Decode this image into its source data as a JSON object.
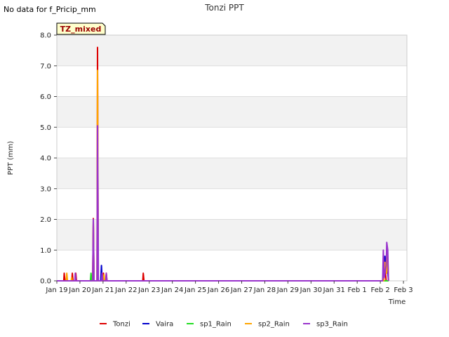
{
  "notice": "No data for f_Pricip_mm",
  "site_badge": "TZ_mixed",
  "chart_data": {
    "type": "line",
    "title": "Tonzi PPT",
    "xlabel": "Time",
    "ylabel": "PPT (mm)",
    "xlim": [
      19.0,
      34.15
    ],
    "ylim": [
      0,
      8
    ],
    "x_ticks": [
      {
        "x": 19,
        "label": "Jan 19"
      },
      {
        "x": 20,
        "label": "Jan 20"
      },
      {
        "x": 21,
        "label": "Jan 21"
      },
      {
        "x": 22,
        "label": "Jan 22"
      },
      {
        "x": 23,
        "label": "Jan 23"
      },
      {
        "x": 24,
        "label": "Jan 24"
      },
      {
        "x": 25,
        "label": "Jan 25"
      },
      {
        "x": 26,
        "label": "Jan 26"
      },
      {
        "x": 27,
        "label": "Jan 27"
      },
      {
        "x": 28,
        "label": "Jan 28"
      },
      {
        "x": 29,
        "label": "Jan 29"
      },
      {
        "x": 30,
        "label": "Jan 30"
      },
      {
        "x": 31,
        "label": "Jan 31"
      },
      {
        "x": 32,
        "label": "Feb 1"
      },
      {
        "x": 33,
        "label": "Feb 2"
      },
      {
        "x": 34,
        "label": "Feb 3"
      }
    ],
    "y_ticks": [
      {
        "y": 0,
        "label": "0.0"
      },
      {
        "y": 1,
        "label": "1.0"
      },
      {
        "y": 2,
        "label": "2.0"
      },
      {
        "y": 3,
        "label": "3.0"
      },
      {
        "y": 4,
        "label": "4.0"
      },
      {
        "y": 5,
        "label": "5.0"
      },
      {
        "y": 6,
        "label": "6.0"
      },
      {
        "y": 7,
        "label": "7.0"
      },
      {
        "y": 8,
        "label": "8.0"
      }
    ],
    "legend_position": "bottom",
    "grid": true,
    "series": [
      {
        "name": "Tonzi",
        "color": "#dd0000",
        "points": [
          [
            19.0,
            0
          ],
          [
            19.3,
            0
          ],
          [
            19.32,
            0.25
          ],
          [
            19.35,
            0
          ],
          [
            19.65,
            0
          ],
          [
            19.67,
            0.25
          ],
          [
            19.7,
            0
          ],
          [
            19.8,
            0
          ],
          [
            19.82,
            0.25
          ],
          [
            19.85,
            0
          ],
          [
            20.55,
            0
          ],
          [
            20.58,
            2.03
          ],
          [
            20.61,
            0
          ],
          [
            20.74,
            0
          ],
          [
            20.76,
            7.6
          ],
          [
            20.79,
            0
          ],
          [
            21.0,
            0
          ],
          [
            21.02,
            0.25
          ],
          [
            21.05,
            0
          ],
          [
            21.12,
            0
          ],
          [
            21.14,
            0.25
          ],
          [
            21.17,
            0
          ],
          [
            22.72,
            0
          ],
          [
            22.74,
            0.25
          ],
          [
            22.77,
            0
          ],
          [
            33.15,
            0
          ],
          [
            33.2,
            0.5
          ],
          [
            33.25,
            0
          ],
          [
            33.35,
            0
          ]
        ]
      },
      {
        "name": "Vaira",
        "color": "#0000cc",
        "points": [
          [
            19.0,
            0
          ],
          [
            20.9,
            0
          ],
          [
            20.93,
            0.5
          ],
          [
            20.96,
            0
          ],
          [
            33.12,
            0
          ],
          [
            33.2,
            0.8
          ],
          [
            33.26,
            0.3
          ],
          [
            33.3,
            0.5
          ],
          [
            33.35,
            0
          ]
        ]
      },
      {
        "name": "sp1_Rain",
        "color": "#22dd22",
        "points": [
          [
            19.0,
            0
          ],
          [
            20.45,
            0
          ],
          [
            20.48,
            0.25
          ],
          [
            20.51,
            0
          ],
          [
            33.35,
            0
          ]
        ]
      },
      {
        "name": "sp2_Rain",
        "color": "#ffa500",
        "points": [
          [
            19.0,
            0
          ],
          [
            19.4,
            0
          ],
          [
            19.43,
            0.25
          ],
          [
            19.46,
            0
          ],
          [
            19.62,
            0
          ],
          [
            19.64,
            0.1
          ],
          [
            19.67,
            0
          ],
          [
            20.55,
            0
          ],
          [
            20.58,
            1.9
          ],
          [
            20.61,
            0
          ],
          [
            20.74,
            0
          ],
          [
            20.76,
            6.85
          ],
          [
            20.79,
            0
          ],
          [
            21.02,
            0
          ],
          [
            21.04,
            0.2
          ],
          [
            21.07,
            0
          ],
          [
            33.15,
            0
          ],
          [
            33.2,
            0.6
          ],
          [
            33.27,
            0.25
          ],
          [
            33.32,
            0.8
          ],
          [
            33.35,
            0
          ]
        ]
      },
      {
        "name": "sp3_Rain",
        "color": "#9933cc",
        "points": [
          [
            19.0,
            0
          ],
          [
            19.78,
            0
          ],
          [
            19.8,
            0.25
          ],
          [
            19.83,
            0
          ],
          [
            20.55,
            0
          ],
          [
            20.58,
            2.0
          ],
          [
            20.61,
            0
          ],
          [
            20.74,
            0
          ],
          [
            20.76,
            5.05
          ],
          [
            20.8,
            0
          ],
          [
            20.93,
            0
          ],
          [
            20.96,
            0.25
          ],
          [
            20.99,
            0
          ],
          [
            21.12,
            0
          ],
          [
            21.14,
            0.25
          ],
          [
            21.17,
            0
          ],
          [
            33.1,
            0
          ],
          [
            33.13,
            1.0
          ],
          [
            33.17,
            0.1
          ],
          [
            33.25,
            0.5
          ],
          [
            33.28,
            1.25
          ],
          [
            33.32,
            1.0
          ],
          [
            33.35,
            0
          ]
        ]
      }
    ]
  }
}
